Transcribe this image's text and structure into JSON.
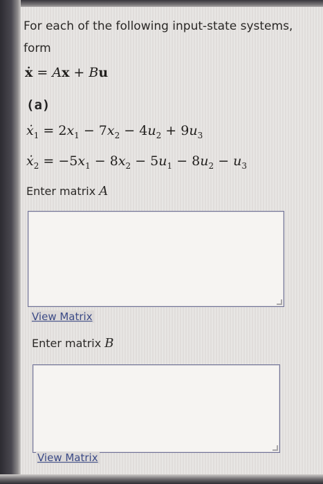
{
  "prompt": {
    "line1": "For each of the following input-state systems,",
    "line2": "form"
  },
  "equation": {
    "lhs": "ẋ",
    "eq": " = ",
    "A": "A",
    "x": "x",
    "plus": " + ",
    "B": "B",
    "u": "u"
  },
  "part_label": "(a)",
  "eq1": {
    "lhs": "ẋ",
    "lhs_sub": "1",
    "rhs_prefix": " = 2",
    "x1": "x",
    "x1_sub": "1",
    "t2": " − 7",
    "x2": "x",
    "x2_sub": "2",
    "t3": " − 4",
    "u2": "u",
    "u2_sub": "2",
    "t4": " + 9",
    "u3": "u",
    "u3_sub": "3"
  },
  "eq2": {
    "lhs": "ẋ",
    "lhs_sub": "2",
    "rhs_prefix": " = −5",
    "x1": "x",
    "x1_sub": "1",
    "t2": " − 8",
    "x2": "x",
    "x2_sub": "2",
    "t3": " − 5",
    "u1": "u",
    "u1_sub": "1",
    "t4": " − 8",
    "u2": "u",
    "u2_sub": "2",
    "t5": " − ",
    "u3": "u",
    "u3_sub": "3"
  },
  "matrix_a": {
    "label": "Enter matrix ",
    "var": "A",
    "value": "",
    "view_link": "View Matrix"
  },
  "matrix_b": {
    "label": "Enter matrix ",
    "var": "B",
    "value": "",
    "view_link": "View Matrix"
  },
  "colors": {
    "link": "#3b4a86",
    "box_border": "#6f7197",
    "panel": "#e7e4e2"
  }
}
